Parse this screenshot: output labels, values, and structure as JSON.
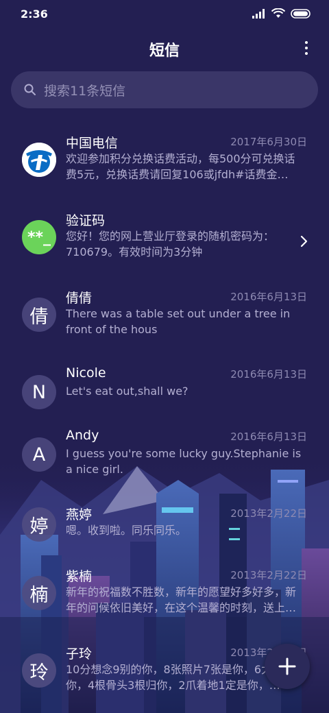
{
  "status": {
    "time": "2:36",
    "icons": [
      "signal-icon",
      "wifi-icon",
      "battery-icon"
    ]
  },
  "header": {
    "title": "短信",
    "more_icon": "more-vertical-icon"
  },
  "search": {
    "placeholder": "搜索11条短信",
    "icon": "search-icon"
  },
  "conversations": [
    {
      "avatar": "",
      "avatar_icon": "china-telecom-logo",
      "name": "中国电信",
      "date": "2017年6月30日",
      "preview": "欢迎参加积分兑换话费活动，每500分可兑换话费5元，兑换话费请回复106或jfdh#话费金…"
    },
    {
      "avatar": "**_",
      "name": "验证码",
      "date": "",
      "preview": "您好！您的网上营业厅登录的随机密码为：710679。有效时间为3分钟",
      "chevron_icon": "chevron-right-icon"
    },
    {
      "avatar": "倩",
      "name": "倩倩",
      "date": "2016年6月13日",
      "preview": "There was a table set out under a tree in front of the hous"
    },
    {
      "avatar": "N",
      "name": "Nicole",
      "date": "2016年6月13日",
      "preview": "Let's eat out,shall we?"
    },
    {
      "avatar": "A",
      "name": "Andy",
      "date": "2016年6月13日",
      "preview": "I guess you're some lucky guy.Stephanie is a nice girl."
    },
    {
      "avatar": "婷",
      "name": "燕婷",
      "date": "2013年2月22日",
      "preview": "嗯。收到啦。同乐同乐。"
    },
    {
      "avatar": "楠",
      "name": "紫楠",
      "date": "2013年2月22日",
      "preview": "新年的祝福数不胜数，新年的愿望好多好多，新年的问候依旧美好，在这个温馨的时刻，送上…"
    },
    {
      "avatar": "玲",
      "name": "子玲",
      "date": "2013年2月22日",
      "preview": "10分想念9别的你，8张照片7张是你，6太阳只像你，4根骨头3根归你，2爪着地1定是你，…"
    }
  ],
  "fab": {
    "icon": "plus-icon"
  },
  "colors": {
    "background": "#231f52",
    "search_bg": "#3a3668",
    "avatar_bg": "#474379",
    "verify_green": "#6bd35a",
    "telecom_blue": "#0a6cc4"
  }
}
